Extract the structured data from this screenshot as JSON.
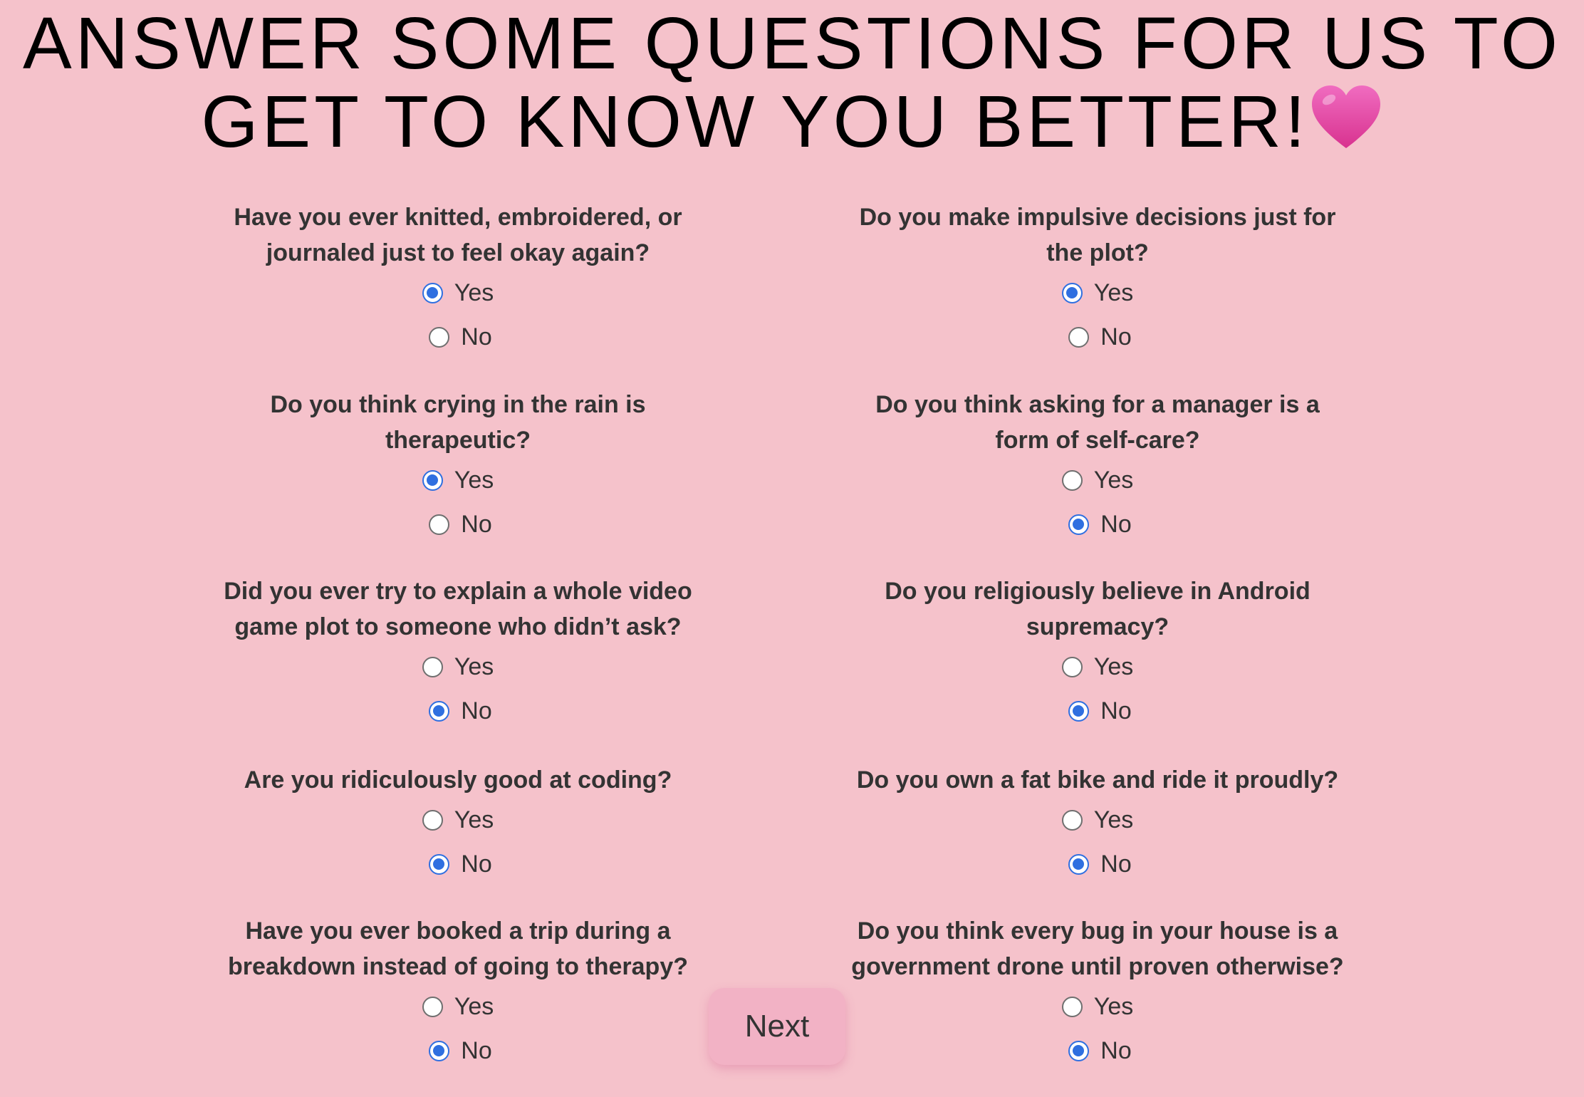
{
  "title": "ANSWER SOME QUESTIONS FOR US TO GET TO KNOW YOU BETTER!",
  "title_icon": "pink-heart-icon",
  "colors": {
    "background": "#f5c2cb",
    "radio_accent": "#2f6fe0",
    "button": "#f2b2c5",
    "heart": "#e64aa6"
  },
  "questions": [
    {
      "text": "Have you ever knitted, embroidered, or journaled just to feel okay again?",
      "yes": "Yes",
      "no": "No",
      "selected": "Yes"
    },
    {
      "text": "Do you make impulsive decisions just for the plot?",
      "yes": "Yes",
      "no": "No",
      "selected": "Yes"
    },
    {
      "text": "Do you think crying in the rain is therapeutic?",
      "yes": "Yes",
      "no": "No",
      "selected": "Yes"
    },
    {
      "text": "Do you think asking for a manager is a form of self-care?",
      "yes": "Yes",
      "no": "No",
      "selected": "No"
    },
    {
      "text": "Did you ever try to explain a whole video game plot to someone who didn’t ask?",
      "yes": "Yes",
      "no": "No",
      "selected": "No"
    },
    {
      "text": "Do you religiously believe in Android supremacy?",
      "yes": "Yes",
      "no": "No",
      "selected": "No"
    },
    {
      "text": "Are you ridiculously good at coding?",
      "yes": "Yes",
      "no": "No",
      "selected": "No"
    },
    {
      "text": "Do you own a fat bike and ride it proudly?",
      "yes": "Yes",
      "no": "No",
      "selected": "No"
    },
    {
      "text": "Have you ever booked a trip during a breakdown instead of going to therapy?",
      "yes": "Yes",
      "no": "No",
      "selected": "No"
    },
    {
      "text": "Do you think every bug in your house is a government drone until proven otherwise?",
      "yes": "Yes",
      "no": "No",
      "selected": "No"
    }
  ],
  "next_button": "Next"
}
